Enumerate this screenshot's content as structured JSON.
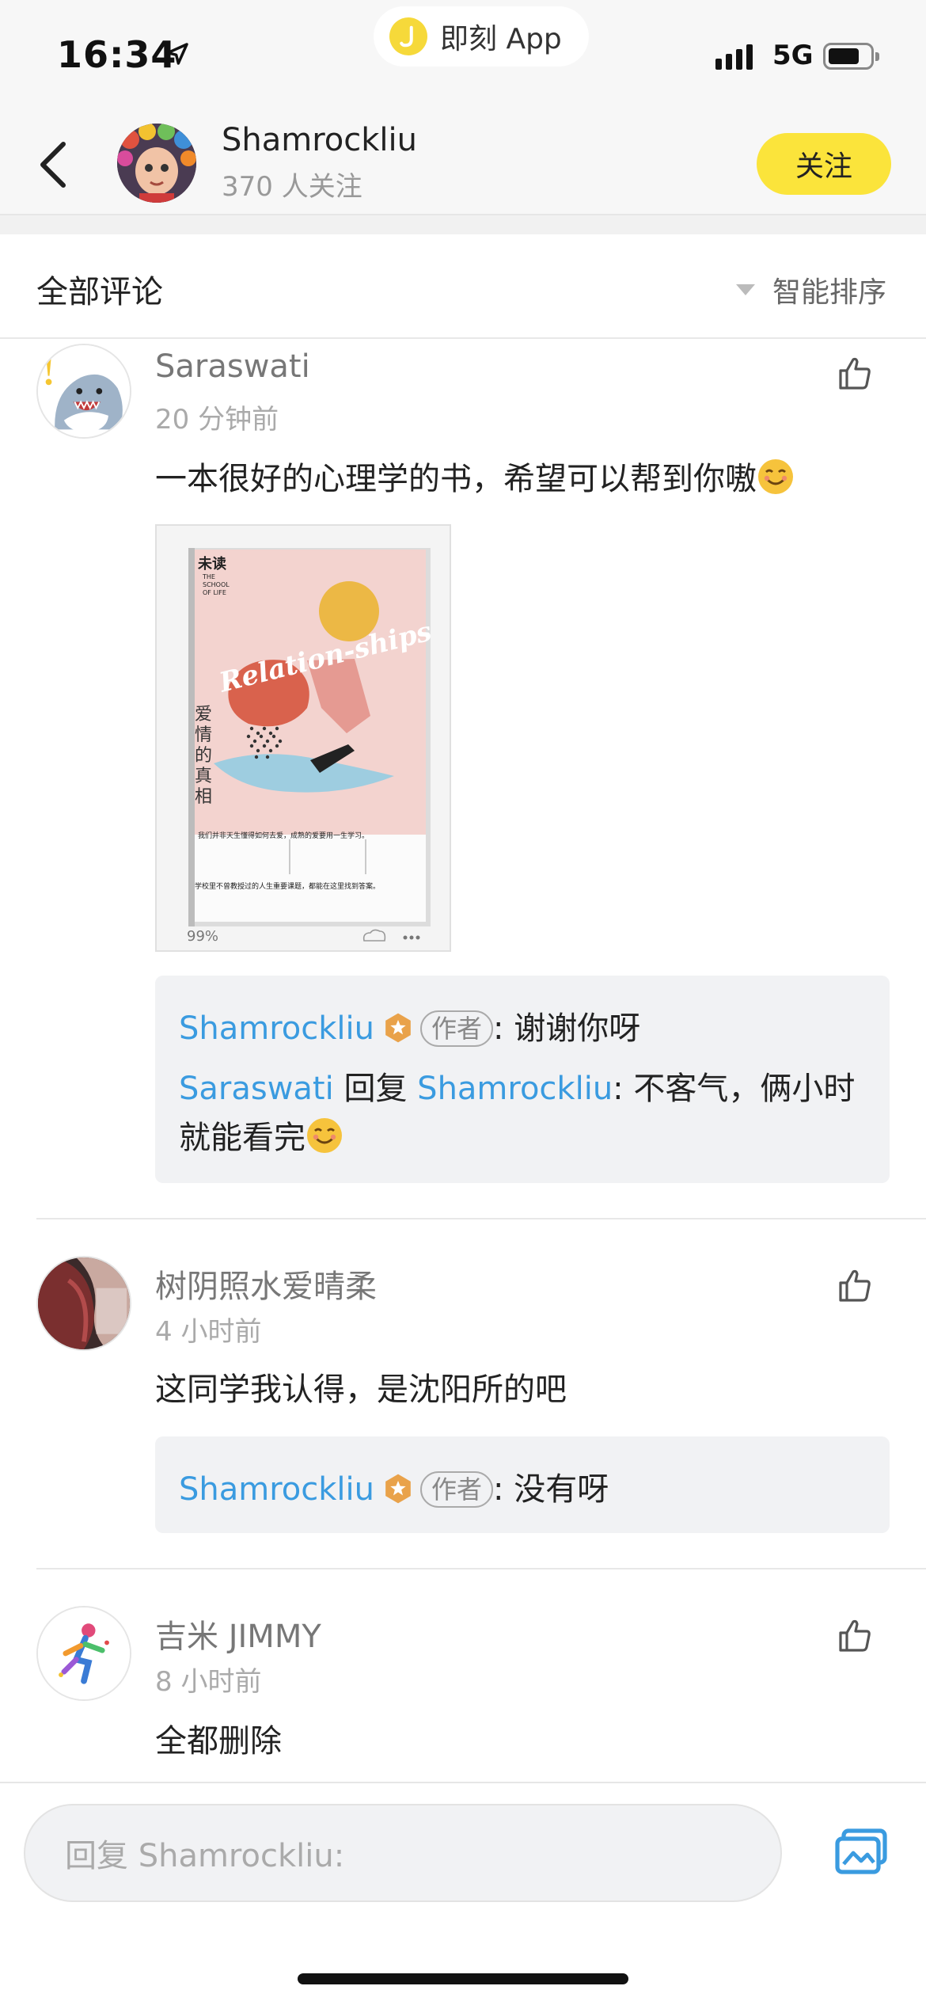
{
  "status_bar": {
    "time": "16:34",
    "app_label": "即刻 App",
    "network": "5G"
  },
  "header": {
    "name": "Shamrockliu",
    "followers": "370 人关注",
    "follow_label": "关注"
  },
  "section": {
    "title": "全部评论",
    "sort_label": "智能排序"
  },
  "comments": [
    {
      "name": "Saraswati",
      "time": "20 分钟前",
      "text": "一本很好的心理学的书，希望可以帮到你嗷",
      "image": {
        "publisher": "未读",
        "series": "THE SCHOOL OF LIFE",
        "title_en": "Relation-ships",
        "title_cn": "爱情的真相",
        "tagline": "我们并非天生懂得如何去爱，成熟的爱要用一生学习。",
        "footer": "学校里不曾教授过的人生重要课题，都能在这里找到答案。",
        "progress": "99%"
      },
      "replies": [
        {
          "from": "Shamrockliu",
          "tag": "作者",
          "text": ": 谢谢你呀"
        },
        {
          "from": "Saraswati",
          "verb": " 回复 ",
          "to": "Shamrockliu",
          "text": ": 不客气，俩小时",
          "text2": "就能看完"
        }
      ]
    },
    {
      "name": "树阴照水爱晴柔",
      "time": "4 小时前",
      "text": "这同学我认得，是沈阳所的吧",
      "replies": [
        {
          "from": "Shamrockliu",
          "tag": "作者",
          "text": ": 没有呀"
        }
      ]
    },
    {
      "name": "吉米 JIMMY",
      "time": "8 小时前",
      "text": "全都删除"
    }
  ],
  "input": {
    "placeholder": "回复 Shamrockliu:"
  },
  "colors": {
    "accent_yellow": "#fbe43b",
    "link_blue": "#3a9be0"
  },
  "icons": [
    "location-arrow-icon",
    "app-logo-icon",
    "signal-icon",
    "battery-icon",
    "back-icon",
    "like-icon",
    "author-badge-icon",
    "smile-emoji-icon",
    "image-picker-icon"
  ]
}
